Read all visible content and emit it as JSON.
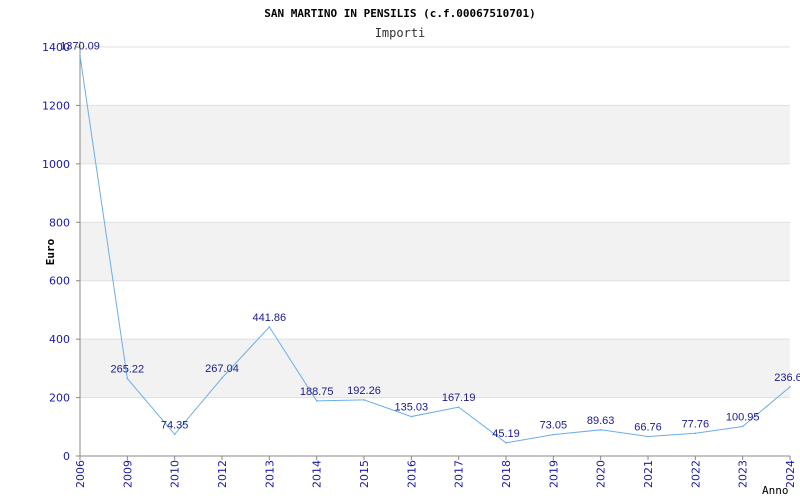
{
  "chart_data": {
    "type": "line",
    "title": "SAN MARTINO IN PENSILIS (c.f.00067510701)",
    "subtitle": "Importi",
    "xlabel": "Anno",
    "ylabel": "Euro",
    "ylim": [
      0,
      1400
    ],
    "yticks": [
      "0",
      "200",
      "400",
      "600",
      "800",
      "1000",
      "1200",
      "1400"
    ],
    "grid": "horizontal alternating bands",
    "categories": [
      "2006",
      "2009",
      "2010",
      "2012",
      "2013",
      "2014",
      "2015",
      "2016",
      "2017",
      "2018",
      "2019",
      "2020",
      "2021",
      "2022",
      "2023",
      "2024"
    ],
    "values": [
      1370.09,
      265.22,
      74.35,
      267.04,
      441.86,
      188.75,
      192.26,
      135.03,
      167.19,
      45.19,
      73.05,
      89.63,
      66.76,
      77.76,
      100.95,
      236.6
    ],
    "labels": [
      "1370.09",
      "265.22",
      "74.35",
      "267.04",
      "441.86",
      "188.75",
      "192.26",
      "135.03",
      "167.19",
      "45.19",
      "73.05",
      "89.63",
      "66.76",
      "77.76",
      "100.95",
      "236.6"
    ],
    "line_color": "#6aaee8",
    "band_color": "#f2f2f2",
    "tick_color": "#1a1aa6"
  }
}
